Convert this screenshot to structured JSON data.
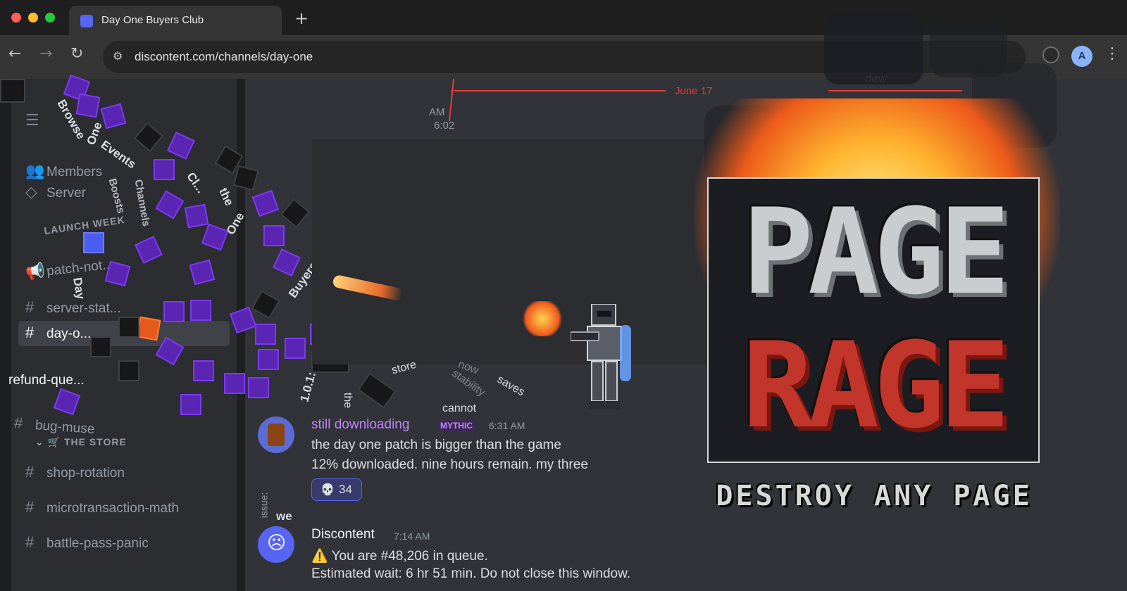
{
  "browser": {
    "tab_title": "Day One Buyers Club",
    "new_tab": "+",
    "url": "discontent.com/channels/day-one",
    "profile_initial": "A",
    "back": "←",
    "forward": "→",
    "reload": "↻",
    "menu": "⋮",
    "traffic_colors": [
      "#ff5f57",
      "#febc2e",
      "#28c840"
    ]
  },
  "sidebar": {
    "items": [
      {
        "icon": "☰",
        "label": "Browse"
      },
      {
        "icon": "👥",
        "label": "Members"
      },
      {
        "icon": "◇",
        "label": "Server"
      },
      {
        "icon": "#",
        "label": "patch-not..."
      },
      {
        "icon": "#",
        "label": "server-stat..."
      },
      {
        "icon": "#",
        "label": "day-o..."
      },
      {
        "icon": "#",
        "label": "refund-que..."
      },
      {
        "icon": "#",
        "label": "bug-muse"
      },
      {
        "icon": "#",
        "label": "shop-rotation"
      },
      {
        "icon": "#",
        "label": "microtransaction-math"
      },
      {
        "icon": "#",
        "label": "battle-pass-panic"
      }
    ],
    "categories": [
      "LAUNCH WEEK",
      "THE STORE"
    ],
    "scattered_words": [
      "One",
      "Events",
      "Cl...",
      "the",
      "One",
      "Buyers",
      "Day",
      "Boosts",
      "Channels",
      "1.0.1:"
    ]
  },
  "chat": {
    "timeline": {
      "time_top": "AM",
      "time_bottom": "6:02",
      "date": "June 17",
      "other": "dew"
    },
    "messages": [
      {
        "username": "still downloading",
        "badge": "MYTHIC",
        "timestamp": "6:31 AM",
        "lines": [
          "the day one patch is bigger than the game",
          "12% downloaded. nine hours remain. my three"
        ],
        "reaction": {
          "emoji": "💀",
          "count": "34"
        }
      },
      {
        "username": "Discontent",
        "timestamp": "7:14 AM",
        "lines": [
          "⚠️ You are #48,206 in queue.",
          "Estimated wait: 6 hr 51 min. Do not close this window."
        ]
      }
    ],
    "floating_words": [
      "we",
      "cannot",
      "saves",
      "now",
      "stability",
      "store",
      "the",
      "issue:"
    ]
  },
  "promo": {
    "title_top": "PAGE",
    "title_bottom": "RAGE",
    "tagline": "DESTROY ANY PAGE"
  },
  "colors": {
    "accent": "#5865f2",
    "cube_purple": "#5a25b3",
    "mythic": "#c084fc",
    "timeline": "#e23b3b"
  }
}
